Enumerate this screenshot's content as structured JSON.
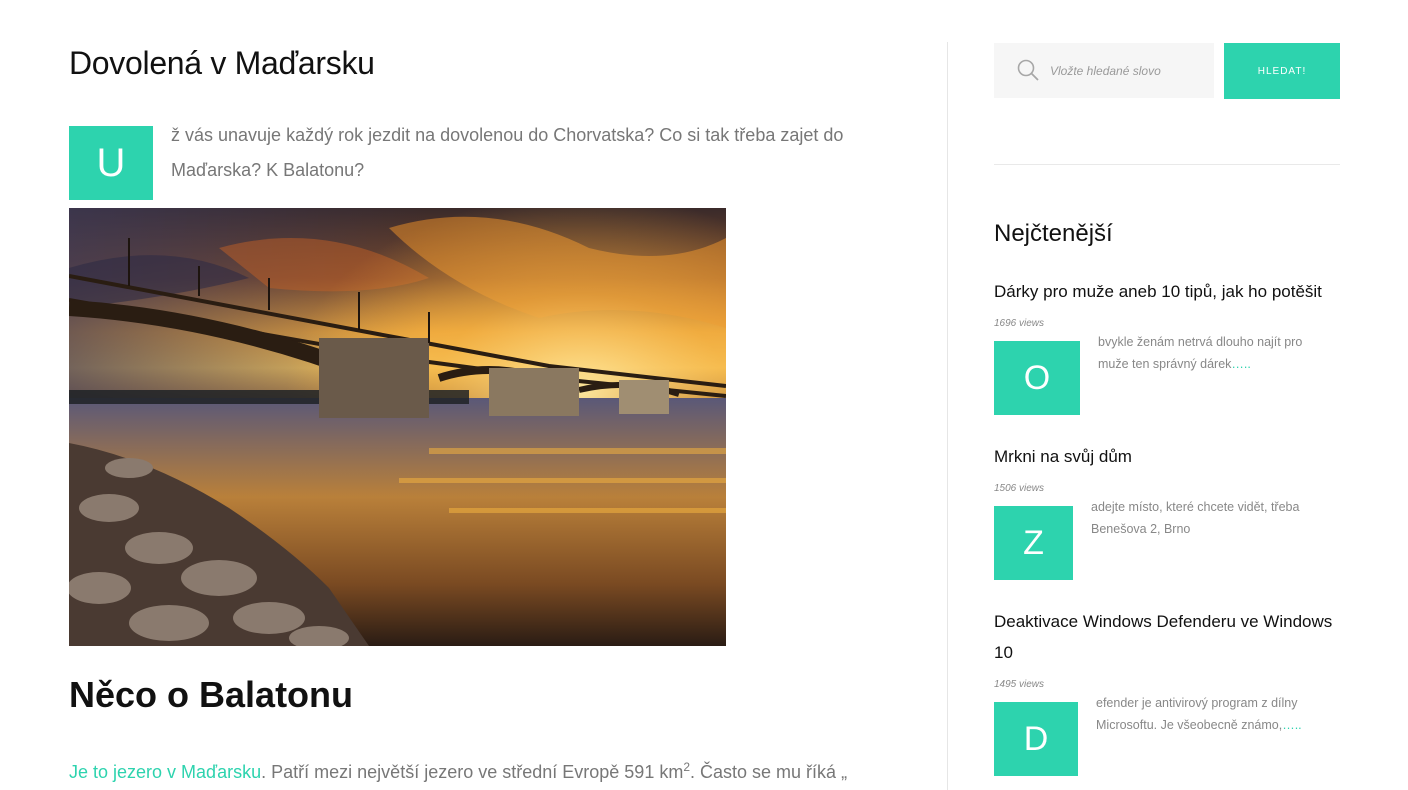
{
  "article": {
    "title": "Dovolená v Maďarsku",
    "dropcap": "U",
    "intro": "ž vás unavuje každý rok jezdit na dovolenou do Chorvatska? Co si tak třeba zajet do Maďarska? K Balatonu?",
    "image_alt": "Most přes řeku při západu slunce",
    "section_title": "Něco o Balatonu",
    "para_link": "Je to jezero v Maďarsku",
    "para_text_1": ". Patří mezi největší jezero ve střední Evropě 591 km",
    "para_sup": "2",
    "para_text_2": ". Často se mu říká „"
  },
  "search": {
    "placeholder": "Vložte hledané slovo",
    "button_label": "HLEDAT!"
  },
  "widget": {
    "title": "Nejčtenější",
    "posts": [
      {
        "title": "Dárky pro muže aneb 10 tipů, jak ho potěšit",
        "views": "1696 views",
        "dropcap": "O",
        "excerpt": "bvykle ženám netrvá dlouho najít pro muže ten správný dárek",
        "more": "….."
      },
      {
        "title": "Mrkni na svůj dům",
        "views": "1506 views",
        "dropcap": "Z",
        "excerpt": "adejte místo, které chcete vidět, třeba Benešova 2, Brno",
        "more": ""
      },
      {
        "title": "Deaktivace Windows Defenderu ve Windows 10",
        "views": "1495 views",
        "dropcap": "D",
        "excerpt": "efender je antivirový program z dílny Microsoftu. Je všeobecně známo,",
        "more": "….."
      }
    ]
  },
  "colors": {
    "accent": "#2dd3ae"
  }
}
